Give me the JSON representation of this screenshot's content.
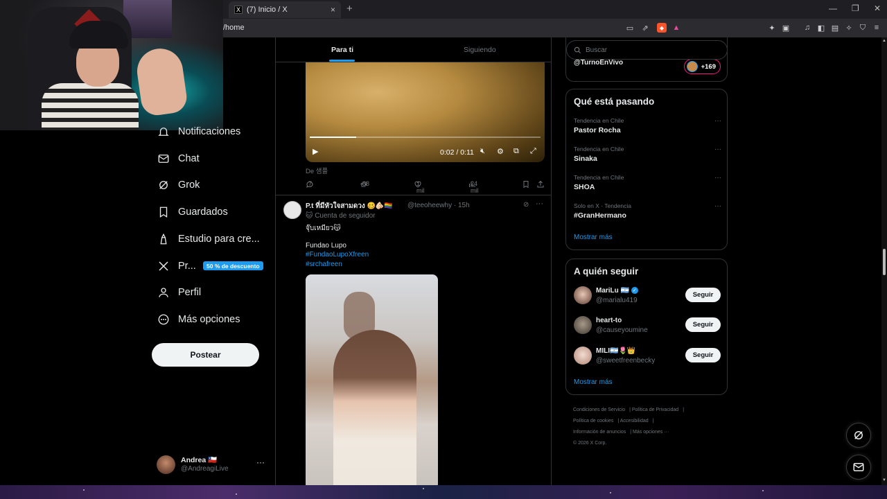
{
  "browser": {
    "tab_title": "(7) Inicio / X",
    "tab_favicon": "X",
    "url": "/home",
    "new_tab": "+",
    "tab_close": "×"
  },
  "nav": {
    "items": [
      {
        "label": "Notificaciones",
        "icon": "bell-icon"
      },
      {
        "label": "Chat",
        "icon": "mail-icon"
      },
      {
        "label": "Grok",
        "icon": "grok-icon"
      },
      {
        "label": "Guardados",
        "icon": "bookmark-icon"
      },
      {
        "label": "Estudio para cre...",
        "icon": "studio-icon"
      },
      {
        "label": "Pr...",
        "icon": "x-logo-icon"
      },
      {
        "label": "Perfil",
        "icon": "person-icon"
      },
      {
        "label": "Más opciones",
        "icon": "more-circle-icon"
      }
    ],
    "premium_badge": "50 % de descuento",
    "post_button": "Postear"
  },
  "account": {
    "name": "Andrea 🇨🇱",
    "handle": "@AndreagiLive",
    "more": "···"
  },
  "timeline": {
    "tabs": [
      {
        "label": "Para ti",
        "active": true
      },
      {
        "label": "Siguiendo",
        "active": false
      }
    ],
    "video_post": {
      "video_time": "0:02 / 0:11",
      "progress_fraction": 0.2,
      "source": "De 샘플",
      "replies": "7",
      "reposts": "68",
      "likes": "1 mil",
      "views": "24 mil"
    },
    "tweet": {
      "name": "P.t ที่มีหัวใจสามดวง 🥴🫵🏻🏳️‍🌈",
      "handle": "@teeoheewhy · 15h",
      "follower_note": "🐱 Cuenta de seguidor",
      "line1": "จุ๊บเหมียว😽",
      "line2": "Fundao Lupo",
      "hashtag1": "#FundaoLupoXfreen",
      "hashtag2": "#srchafreen",
      "more": "···"
    }
  },
  "right": {
    "search_placeholder": "Buscar",
    "live": {
      "handle": "@TurnoEnVivo",
      "count": "+169"
    },
    "trends_title": "Qué está pasando",
    "trends": [
      {
        "context": "Tendencia en Chile",
        "topic": "Pastor Rocha"
      },
      {
        "context": "Tendencia en Chile",
        "topic": "Sinaka"
      },
      {
        "context": "Tendencia en Chile",
        "topic": "SHOA"
      },
      {
        "context": "Solo en X · Tendencia",
        "topic": "#GranHermano"
      }
    ],
    "trends_more": "Mostrar más",
    "trend_dots": "···",
    "follow_title": "A quién seguir",
    "follow": [
      {
        "name": "MariLu 🇦🇷",
        "handle": "@marialu419",
        "button": "Seguir",
        "verified": true
      },
      {
        "name": "heart-to",
        "handle": "@causeyoumine",
        "button": "Seguir",
        "verified": false
      },
      {
        "name": "MILI🇦🇷🌷👑",
        "handle": "@sweetfreenbecky",
        "button": "Seguir",
        "verified": false
      }
    ],
    "follow_more": "Mostrar más",
    "footer": {
      "terms": "Condiciones de Servicio",
      "privacy": "Política de Privacidad",
      "cookies": "Política de cookies",
      "accessibility": "Accesibilidad",
      "ads": "Información de anuncios",
      "more": "Más opciones ···",
      "copyright": "© 2026 X Corp."
    }
  },
  "colors": {
    "accent": "#1d9bf0",
    "live_border": "#f91880",
    "background": "#000000",
    "secondary_text": "#71767b"
  }
}
